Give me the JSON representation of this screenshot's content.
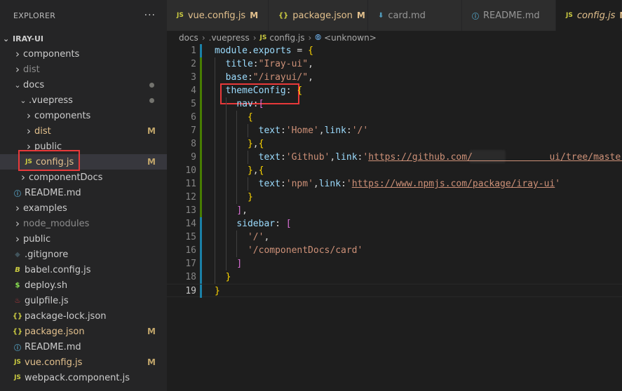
{
  "explorer": {
    "title": "EXPLORER",
    "more_icon": "ellipsis-icon",
    "project": "IRAY-UI"
  },
  "tree": [
    {
      "label": "components",
      "type": "folder",
      "expanded": false,
      "badge": ""
    },
    {
      "label": "dist",
      "type": "folder",
      "expanded": false,
      "badge": "",
      "dim": true
    },
    {
      "label": "docs",
      "type": "folder",
      "expanded": true,
      "badge": "dot"
    },
    {
      "label": ".vuepress",
      "type": "folder",
      "expanded": true,
      "badge": "dot"
    },
    {
      "label": "components",
      "type": "folder",
      "expanded": false,
      "badge": ""
    },
    {
      "label": "dist",
      "type": "folder",
      "expanded": false,
      "badge": "M"
    },
    {
      "label": "public",
      "type": "folder",
      "expanded": false,
      "badge": ""
    },
    {
      "label": "config.js",
      "type": "js",
      "badge": "M",
      "selected": true
    },
    {
      "label": "componentDocs",
      "type": "folder",
      "expanded": false,
      "badge": ""
    },
    {
      "label": "README.md",
      "type": "info",
      "badge": ""
    },
    {
      "label": "examples",
      "type": "folder",
      "expanded": false,
      "badge": ""
    },
    {
      "label": "node_modules",
      "type": "folder",
      "expanded": false,
      "badge": "",
      "dim": true
    },
    {
      "label": "public",
      "type": "folder",
      "expanded": false,
      "badge": ""
    },
    {
      "label": ".gitignore",
      "type": "git",
      "badge": ""
    },
    {
      "label": "babel.config.js",
      "type": "babel",
      "badge": ""
    },
    {
      "label": "deploy.sh",
      "type": "sh",
      "badge": ""
    },
    {
      "label": "gulpfile.js",
      "type": "gulp",
      "badge": ""
    },
    {
      "label": "package-lock.json",
      "type": "json",
      "badge": ""
    },
    {
      "label": "package.json",
      "type": "json",
      "badge": "M"
    },
    {
      "label": "README.md",
      "type": "info",
      "badge": ""
    },
    {
      "label": "vue.config.js",
      "type": "js",
      "badge": "M"
    },
    {
      "label": "webpack.component.js",
      "type": "js",
      "badge": ""
    }
  ],
  "tabs": [
    {
      "label": "vue.config.js",
      "icon": "JS",
      "modified": "M",
      "active": false
    },
    {
      "label": "package.json",
      "icon": "{}",
      "modified": "M",
      "active": false
    },
    {
      "label": "card.md",
      "icon": "⬇",
      "modified": "",
      "active": false
    },
    {
      "label": "README.md",
      "icon": "ⓘ",
      "modified": "",
      "active": false
    },
    {
      "label": "config.js",
      "icon": "JS",
      "modified": "M",
      "active": true
    }
  ],
  "breadcrumb": {
    "parts": [
      "docs",
      ".vuepress",
      "config.js",
      "<unknown>"
    ]
  },
  "editor": {
    "lines": [
      "module.exports = {",
      "  title:\"Iray-ui\",",
      "  base:\"/irayui/\",",
      "  themeConfig: {",
      "    nav:[",
      "      {",
      "        text:'Home',link:'/'",
      "      },{",
      "        text:'Github',link:'https://github.com/              ui/tree/master'",
      "      },{",
      "        text:'npm',link:'https://www.npmjs.com/package/iray-ui'",
      "      }",
      "    ],",
      "    sidebar: [",
      "      '/',",
      "      '/componentDocs/card'",
      "    ]",
      "  }",
      "}"
    ]
  },
  "colors": {
    "highlight_box": "#e8393a",
    "modified_badge": "#e2c08d",
    "gutter_modified": "#1b81a8",
    "gutter_added": "#487e02"
  }
}
